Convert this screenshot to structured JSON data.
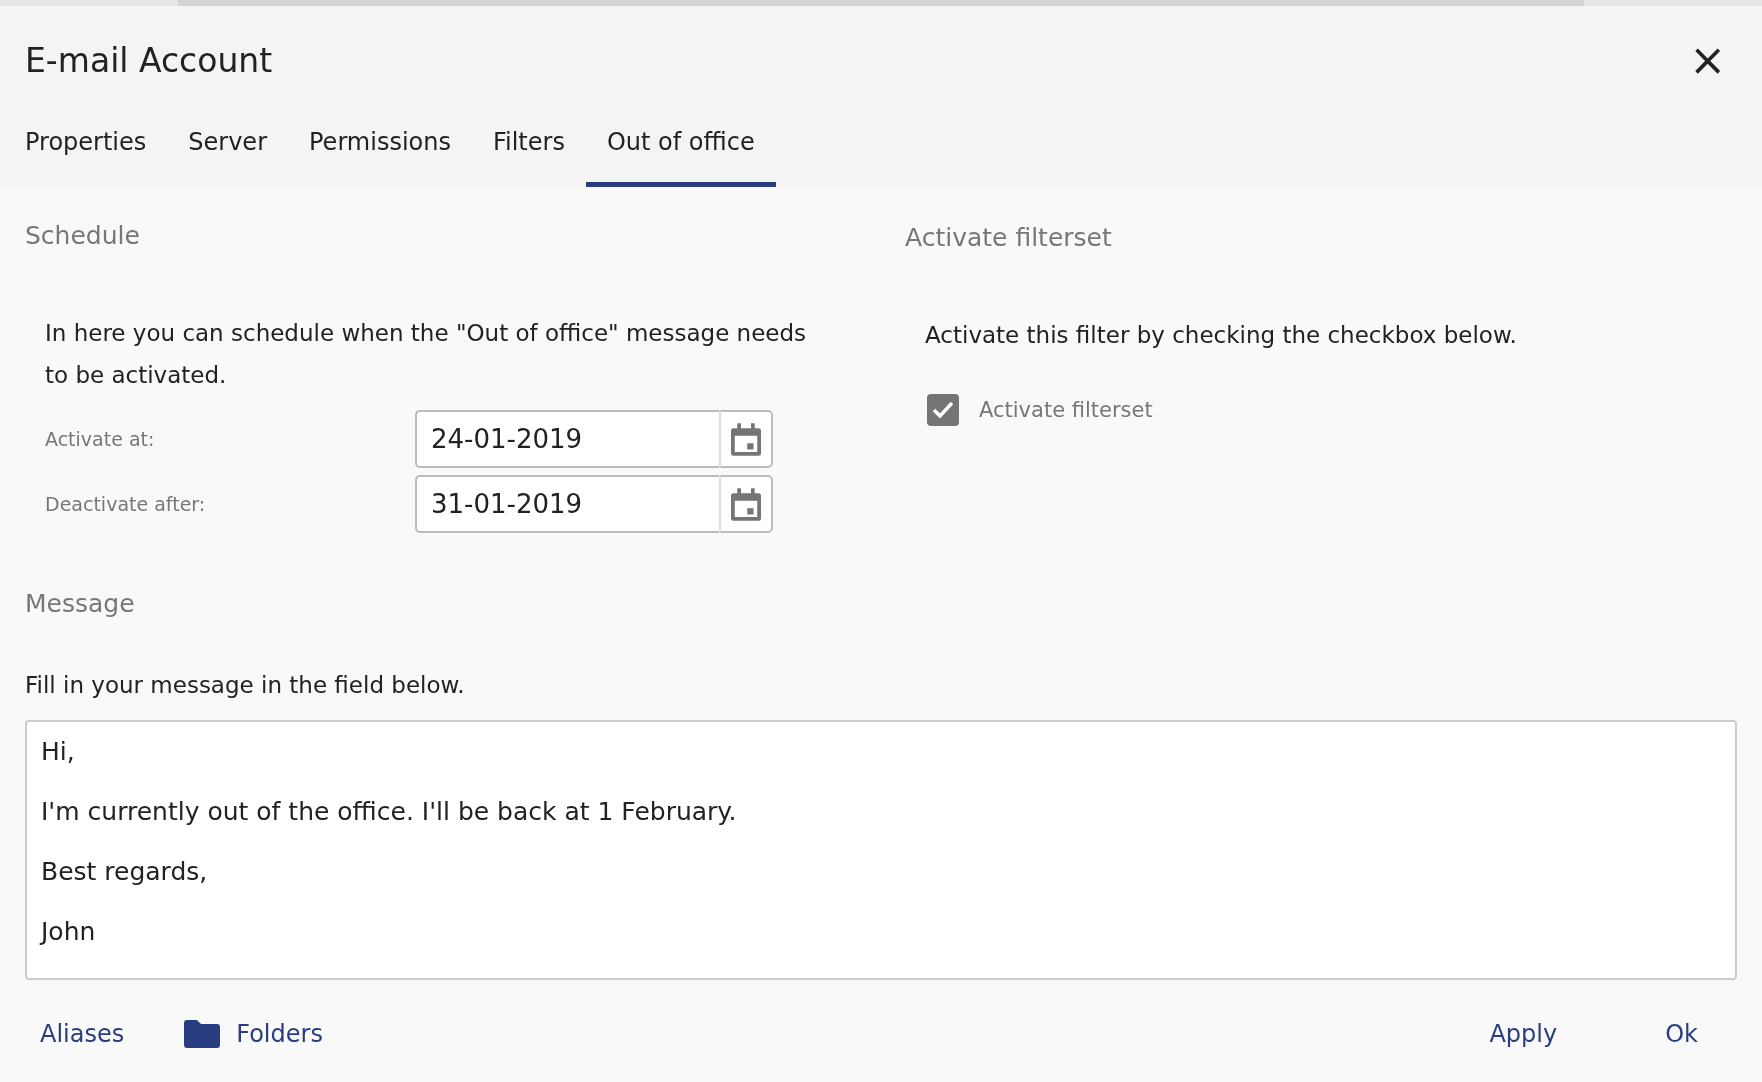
{
  "dialog": {
    "title": "E-mail Account",
    "close": "×"
  },
  "tabs": [
    {
      "label": "Properties",
      "selected": false
    },
    {
      "label": "Server",
      "selected": false
    },
    {
      "label": "Permissions",
      "selected": false
    },
    {
      "label": "Filters",
      "selected": false
    },
    {
      "label": "Out of office",
      "selected": true
    }
  ],
  "schedule": {
    "heading": "Schedule",
    "description": "In here you can schedule when the \"Out of office\" message needs to be activated.",
    "fields": [
      {
        "label": "Activate at:",
        "value": "24-01-2019"
      },
      {
        "label": "Deactivate after:",
        "value": "31-01-2019"
      }
    ]
  },
  "filterset": {
    "heading": "Activate filterset",
    "description": "Activate this filter by checking the checkbox below.",
    "checkbox": {
      "label": "Activate filterset",
      "checked": true
    }
  },
  "message": {
    "heading": "Message",
    "description": "Fill in your message in the field below.",
    "value": "Hi,\nI'm currently out of the office. I'll be back at 1 February.\nBest regards,\nJohn"
  },
  "footer": {
    "left": [
      {
        "label": "Aliases",
        "kind": "plain"
      },
      {
        "label": "Folders",
        "kind": "folder"
      }
    ],
    "right": [
      "Apply",
      "Ok"
    ]
  }
}
